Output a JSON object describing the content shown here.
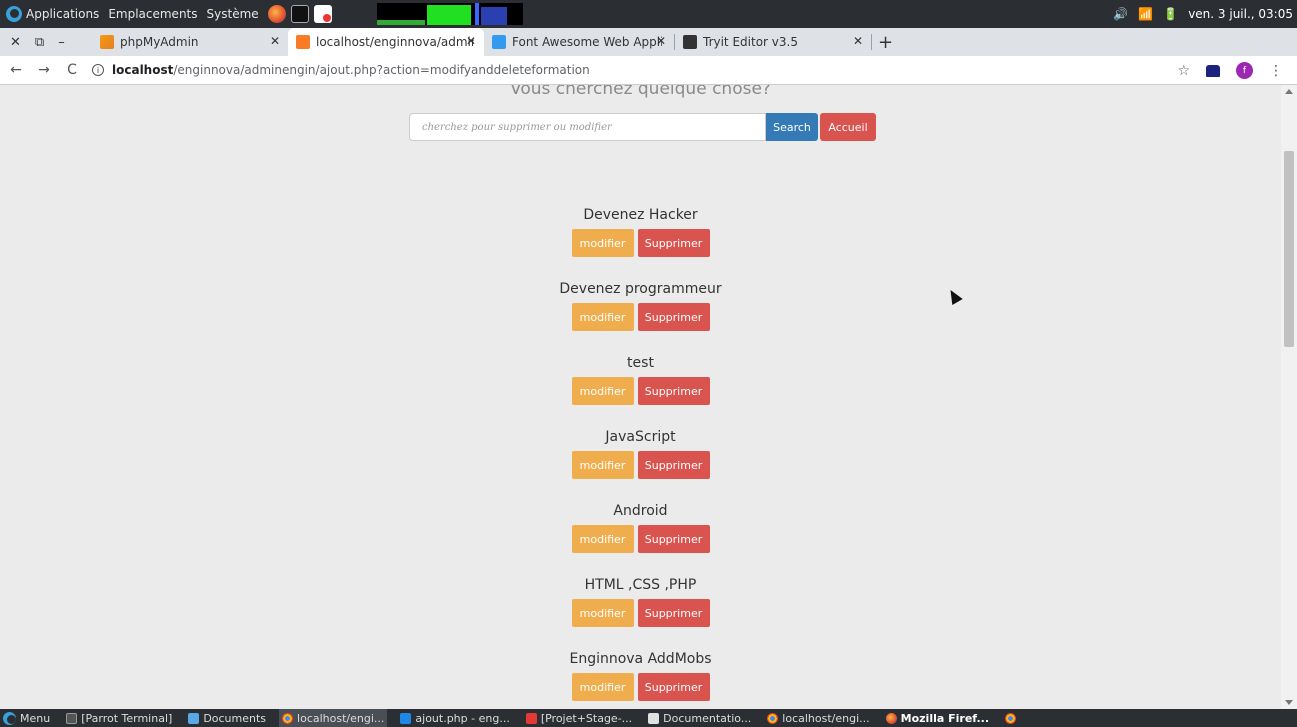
{
  "system_panel": {
    "menus": [
      "Applications",
      "Emplacements",
      "Système"
    ],
    "clock": "ven. 3 juil., 03:05"
  },
  "tabs": [
    {
      "title": "phpMyAdmin",
      "icon": "phpmyadmin-icon",
      "active": false
    },
    {
      "title": "localhost/enginnova/admin",
      "icon": "xampp-icon",
      "active": true
    },
    {
      "title": "Font Awesome Web Applic",
      "icon": "fontawesome-icon",
      "active": false
    },
    {
      "title": "Tryit Editor v3.5",
      "icon": "tryit-icon",
      "active": false
    }
  ],
  "url": {
    "host": "localhost",
    "path": "/enginnova/adminengin/ajout.php?action=modifyanddeleteformation"
  },
  "profile_initial": "f",
  "page": {
    "heading": "Vous cherchez quelque chose?",
    "search_placeholder": "cherchez pour supprimer ou modifier",
    "search_label": "Search",
    "home_label": "Accueil",
    "modify_label": "modifier",
    "delete_label": "Supprimer",
    "formations": [
      "Devenez Hacker",
      "Devenez programmeur",
      "test",
      "JavaScript",
      "Android",
      "HTML ,CSS ,PHP",
      "Enginnova AddMobs"
    ]
  },
  "taskbar": {
    "menu_label": "Menu",
    "items": [
      {
        "label": "[Parrot Terminal]",
        "icon": "terminal-icon",
        "active": false,
        "bold": false
      },
      {
        "label": "Documents",
        "icon": "folder-icon",
        "active": false,
        "bold": false
      },
      {
        "label": "localhost/engi...",
        "icon": "chrome-icon",
        "active": true,
        "bold": false
      },
      {
        "label": "ajout.php - eng...",
        "icon": "vscode-icon",
        "active": false,
        "bold": false
      },
      {
        "label": "[Projet+Stage-...",
        "icon": "pdf-icon",
        "active": false,
        "bold": false
      },
      {
        "label": "Documentatio...",
        "icon": "document-icon",
        "active": false,
        "bold": false
      },
      {
        "label": "localhost/engi...",
        "icon": "chrome-icon",
        "active": false,
        "bold": false
      },
      {
        "label": "Mozilla Firef...",
        "icon": "firefox-icon",
        "active": false,
        "bold": true
      }
    ]
  },
  "colors": {
    "primary": "#337ab7",
    "danger": "#d9534f",
    "warning": "#f0ad4e"
  }
}
